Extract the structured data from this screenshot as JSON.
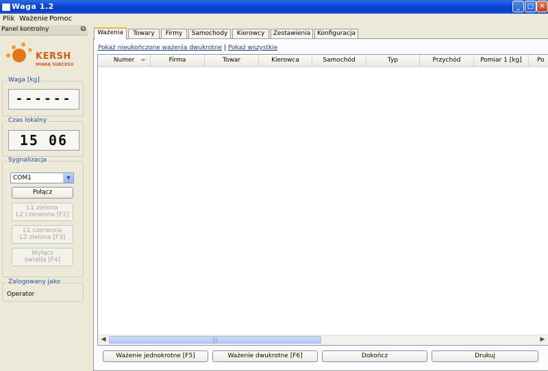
{
  "window": {
    "title": "Waga 1.2"
  },
  "menu": [
    "Plik",
    "Ważenie",
    "Pomoc"
  ],
  "left_panel": {
    "title": "Panel kontrolny",
    "logo_text": "KERSH",
    "logo_sub": "MIARĄ SUKCESU",
    "weight_group": {
      "legend": "Waga [kg]",
      "value": "------"
    },
    "time_group": {
      "legend": "Czas lokalny",
      "value": "15 06"
    },
    "signal_group": {
      "legend": "Sygnalizacja",
      "port": "COM1",
      "connect": "Połącz",
      "btn1_line1": "L1 zielona",
      "btn1_line2": "L2 czerwona [F2]",
      "btn2_line1": "L1 czerwona",
      "btn2_line2": "L2 zielona [F3]",
      "btn3_line1": "Wyłącz",
      "btn3_line2": "światła [F4]"
    },
    "login_group": {
      "legend": "Zalogowany jako",
      "user": "Operator"
    }
  },
  "tabs": [
    "Ważenia",
    "Towary",
    "Firmy",
    "Samochody",
    "Kierowcy",
    "Zestawienia",
    "Konfiguracja"
  ],
  "active_tab": "Ważenia",
  "links": {
    "incomplete": "Pokaż nieukończone ważenia dwukrotne",
    "separator": "|",
    "all": "Pokaż wszystkie"
  },
  "table": {
    "columns": [
      "Numer",
      "Firma",
      "Towar",
      "Kierowca",
      "Samochód",
      "Typ",
      "Przychód",
      "Pomiar 1 [kg]",
      "Po"
    ],
    "rows": []
  },
  "scrollbar_grip": "|||",
  "buttons": {
    "single": "Ważenie jednokrotne [F5]",
    "double": "Ważenie dwukrotne [F6]",
    "finish": "Dokończ",
    "print": "Drukuj"
  },
  "colors": {
    "titlebar": "#0a46d6",
    "tab_highlight": "#f0b034",
    "logo": "#d65a18",
    "link": "#1b3c9c"
  }
}
